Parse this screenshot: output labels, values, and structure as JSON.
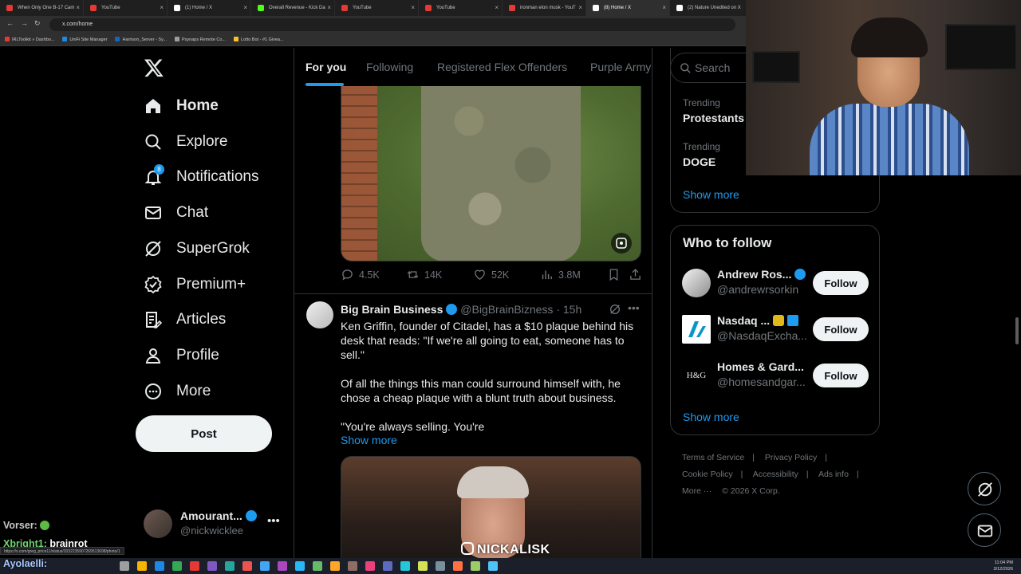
{
  "browser": {
    "tabs": [
      {
        "label": "When Only One B-17 Cam",
        "color": "#e53935"
      },
      {
        "label": "YouTube",
        "color": "#e53935"
      },
      {
        "label": "(1) Home / X",
        "color": "#ffffff"
      },
      {
        "label": "Overall Revenue - Kick Da",
        "color": "#53fc18"
      },
      {
        "label": "YouTube",
        "color": "#e53935"
      },
      {
        "label": "YouTube",
        "color": "#e53935"
      },
      {
        "label": "ironman elon musk - YouT",
        "color": "#e53935"
      },
      {
        "label": "(8) Home / X",
        "color": "#ffffff"
      },
      {
        "label": "(2) Nature Unedited on X",
        "color": "#ffffff"
      }
    ],
    "url": "x.com/home",
    "bookmarks": [
      "IRLToolkit » Dashbo...",
      "UniFi Site Manager",
      "Harrison_Server - Sy...",
      "Psynaps Remote Co...",
      "Lotto Bot - #1 Givea..."
    ]
  },
  "nav": {
    "items": [
      {
        "label": "Home",
        "icon": "home-icon"
      },
      {
        "label": "Explore",
        "icon": "search-icon"
      },
      {
        "label": "Notifications",
        "icon": "bell-icon",
        "badge": "8"
      },
      {
        "label": "Chat",
        "icon": "mail-icon"
      },
      {
        "label": "SuperGrok",
        "icon": "grok-icon"
      },
      {
        "label": "Premium+",
        "icon": "verified-icon"
      },
      {
        "label": "Articles",
        "icon": "article-icon"
      },
      {
        "label": "Profile",
        "icon": "person-icon"
      },
      {
        "label": "More",
        "icon": "more-circle-icon"
      }
    ],
    "post_label": "Post",
    "account": {
      "name": "Amourant...",
      "handle": "@nickwicklee"
    }
  },
  "feed": {
    "tabs": [
      "For you",
      "Following",
      "Registered Flex Offenders",
      "Purple Army"
    ],
    "tweet1": {
      "replies": "4.5K",
      "reposts": "14K",
      "likes": "52K",
      "views": "3.8M"
    },
    "tweet2": {
      "name": "Big Brain Business",
      "handle": "@BigBrainBizness",
      "time": "15h",
      "paragraphs": [
        "Ken Griffin, founder of Citadel, has a $10 plaque behind his desk that reads: \"If we're all going to eat, someone has to sell.\"",
        "Of all the things this man could surround himself with, he chose a cheap plaque with a blunt truth about business.",
        "\"You're always selling. You're"
      ],
      "show_more": "Show more"
    }
  },
  "sidebar": {
    "search_placeholder": "Search",
    "trends": [
      {
        "category": "Trending",
        "topic": "Protestants"
      },
      {
        "category": "Trending",
        "topic": "DOGE"
      }
    ],
    "show_more": "Show more",
    "who_to_follow": {
      "title": "Who to follow",
      "people": [
        {
          "name": "Andrew Ros...",
          "handle": "@andrewrsorkin",
          "button": "Follow"
        },
        {
          "name": "Nasdaq ...",
          "handle": "@NasdaqExcha...",
          "button": "Follow"
        },
        {
          "name": "Homes & Gard...",
          "handle": "@homesandgar...",
          "button": "Follow",
          "logo": "H&G"
        }
      ],
      "show_more": "Show more"
    },
    "footer": [
      "Terms of Service",
      "Privacy Policy",
      "Cookie Policy",
      "Accessibility",
      "Ads info",
      "More ···",
      "© 2026 X Corp."
    ]
  },
  "overlay": {
    "chat": [
      {
        "user": "Vorser:",
        "text": "",
        "color": "#c8c8c8"
      },
      {
        "user": "Xbright1:",
        "text": "brainrot",
        "color": "#6fd36f"
      },
      {
        "user": "Ayolaelli:",
        "text": "",
        "color": "#a8c8ff"
      }
    ],
    "status_url": "https://x.com/greg_price11/status/2032235907269513698/photo/1",
    "watermark": "NICKALISK",
    "clock_time": "11:04 PM",
    "clock_date": "3/12/2026"
  },
  "colors": {
    "accent": "#1d9bf0",
    "background": "#000000",
    "border": "#2f3336",
    "muted": "#71767b"
  }
}
